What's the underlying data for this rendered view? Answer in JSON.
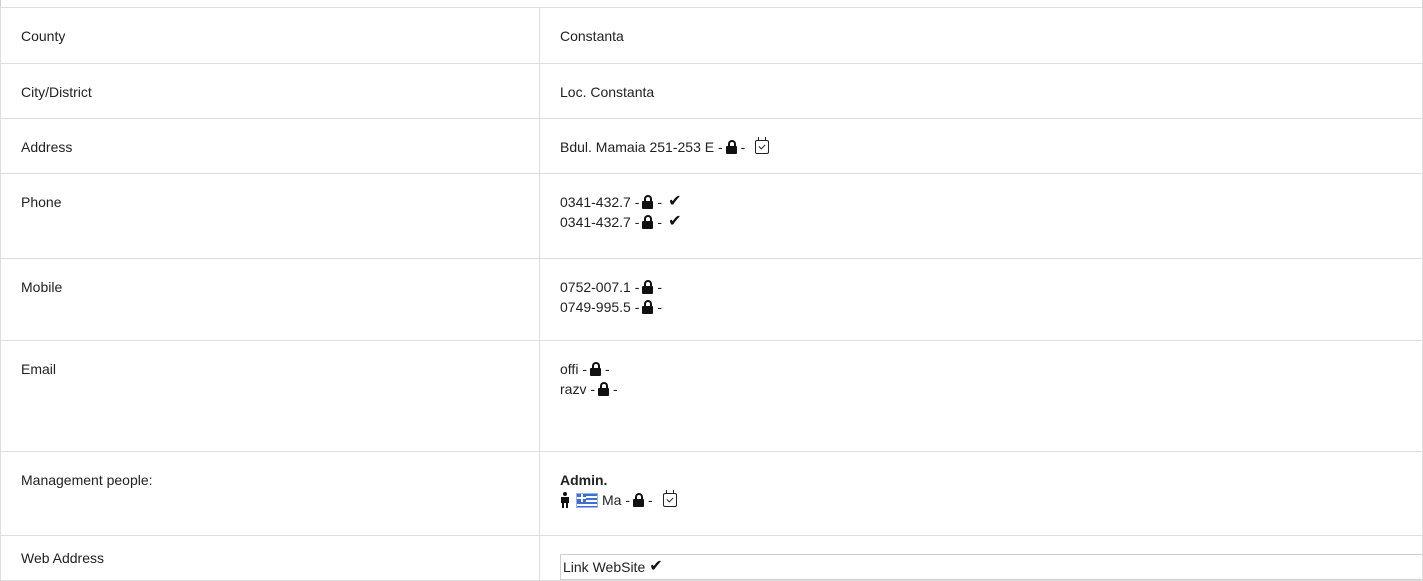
{
  "rows": [
    {
      "label": "County",
      "value": "Constanta"
    },
    {
      "label": "City/District",
      "value": "Loc. Constanta"
    },
    {
      "label": "Address",
      "value": "Bdul. Mamaia 251-253 E -",
      "sep": "-"
    },
    {
      "label": "Phone",
      "lines": [
        {
          "text": "0341-432.7 -",
          "sep": "-"
        },
        {
          "text": "0341-432.7 -",
          "sep": "-"
        }
      ]
    },
    {
      "label": "Mobile",
      "lines": [
        {
          "text": "0752-007.1 -",
          "sep": "-"
        },
        {
          "text": "0749-995.5 -",
          "sep": "-"
        }
      ]
    },
    {
      "label": "Email",
      "lines": [
        {
          "text": "offi -",
          "sep": "-"
        },
        {
          "text": "razv -",
          "sep": "-"
        }
      ]
    },
    {
      "label": "Management people:",
      "role": "Admin.",
      "person": {
        "text": "Ma -",
        "sep": "-"
      }
    },
    {
      "label": "Web Address",
      "link": "Link WebSite"
    }
  ],
  "icons": {
    "lock": "lock-icon",
    "check": "checkmark-icon",
    "calendar": "calendar-check-icon",
    "person": "person-icon",
    "flag": "greece-flag-icon"
  },
  "colors": {
    "border": "#dedede",
    "text": "#222222",
    "flag_blue": "#3a6fd8"
  }
}
